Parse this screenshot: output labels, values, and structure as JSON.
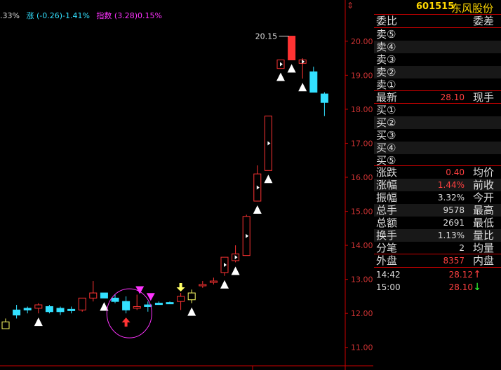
{
  "top_info": {
    "pct_partial": ".33%",
    "rise_label": "涨",
    "rise_value": "(-0.26)-1.41%",
    "index_label": "指数",
    "index_value": "(3.28)0.15%"
  },
  "chart_data": {
    "type": "candlestick",
    "y_ticks": [
      "20.00",
      "19.00",
      "18.00",
      "17.00",
      "16.00",
      "15.00",
      "14.00",
      "13.00",
      "12.00",
      "11.00"
    ],
    "y_tick_values": [
      20,
      19,
      18,
      17,
      16,
      15,
      14,
      13,
      12,
      11
    ],
    "ylim": [
      10.5,
      20.8
    ],
    "peak_label": "20.15",
    "peak_value": 20.15,
    "candles": [
      {
        "o": 11.75,
        "h": 11.85,
        "l": 11.55,
        "c": 11.55,
        "color": "yellow"
      },
      {
        "o": 11.95,
        "h": 12.25,
        "l": 11.85,
        "c": 12.1,
        "color": "cyan"
      },
      {
        "o": 12.1,
        "h": 12.2,
        "l": 12.0,
        "c": 12.15,
        "color": "cyan"
      },
      {
        "o": 12.15,
        "h": 12.3,
        "l": 12.0,
        "c": 12.25,
        "color": "red"
      },
      {
        "o": 12.2,
        "h": 12.25,
        "l": 12.0,
        "c": 12.05,
        "color": "cyan"
      },
      {
        "o": 12.05,
        "h": 12.2,
        "l": 11.95,
        "c": 12.15,
        "color": "cyan"
      },
      {
        "o": 12.1,
        "h": 12.2,
        "l": 12.0,
        "c": 12.12,
        "color": "cyan"
      },
      {
        "o": 12.1,
        "h": 12.25,
        "l": 12.05,
        "c": 12.45,
        "color": "red"
      },
      {
        "o": 12.45,
        "h": 12.95,
        "l": 12.35,
        "c": 12.6,
        "color": "red"
      },
      {
        "o": 12.6,
        "h": 12.6,
        "l": 12.45,
        "c": 12.45,
        "color": "cyan"
      },
      {
        "o": 12.45,
        "h": 12.55,
        "l": 12.3,
        "c": 12.35,
        "color": "cyan"
      },
      {
        "o": 12.35,
        "h": 12.5,
        "l": 12.0,
        "c": 12.1,
        "color": "cyan"
      },
      {
        "o": 12.15,
        "h": 12.55,
        "l": 12.1,
        "c": 12.2,
        "color": "red"
      },
      {
        "o": 12.2,
        "h": 12.35,
        "l": 12.05,
        "c": 12.25,
        "color": "cyan"
      },
      {
        "o": 12.3,
        "h": 12.35,
        "l": 12.25,
        "c": 12.3,
        "color": "cyan"
      },
      {
        "o": 12.3,
        "h": 12.35,
        "l": 12.3,
        "c": 12.32,
        "color": "cyan"
      },
      {
        "o": 12.35,
        "h": 12.6,
        "l": 12.1,
        "c": 12.5,
        "color": "red"
      },
      {
        "o": 12.4,
        "h": 12.7,
        "l": 12.3,
        "c": 12.6,
        "color": "yellow"
      },
      {
        "o": 12.85,
        "h": 12.95,
        "l": 12.75,
        "c": 12.85,
        "color": "red"
      },
      {
        "o": 12.95,
        "h": 13.05,
        "l": 12.85,
        "c": 12.95,
        "color": "red"
      },
      {
        "o": 13.2,
        "h": 13.3,
        "l": 13.1,
        "c": 13.65,
        "color": "red"
      },
      {
        "o": 13.55,
        "h": 14.0,
        "l": 13.5,
        "c": 13.75,
        "color": "red"
      },
      {
        "o": 13.7,
        "h": 14.9,
        "l": 13.7,
        "c": 14.85,
        "color": "red"
      },
      {
        "o": 15.3,
        "h": 16.35,
        "l": 15.3,
        "c": 16.1,
        "color": "red"
      },
      {
        "o": 16.2,
        "h": 17.8,
        "l": 16.2,
        "c": 17.8,
        "color": "red"
      },
      {
        "o": 19.2,
        "h": 19.45,
        "l": 19.2,
        "c": 19.45,
        "color": "red"
      },
      {
        "o": 19.45,
        "h": 20.15,
        "l": 19.45,
        "c": 20.15,
        "color": "redfill"
      },
      {
        "o": 19.45,
        "h": 19.5,
        "l": 18.9,
        "c": 19.35,
        "color": "red"
      },
      {
        "o": 19.1,
        "h": 19.25,
        "l": 18.5,
        "c": 18.5,
        "color": "cyan"
      },
      {
        "o": 18.45,
        "h": 18.5,
        "l": 17.8,
        "c": 18.2,
        "color": "cyan"
      }
    ]
  },
  "panel": {
    "code": "601515",
    "name": "东风股份",
    "weibi": "委比",
    "weicha": "委差",
    "sell": [
      "卖⑤",
      "卖④",
      "卖③",
      "卖②",
      "卖①"
    ],
    "latest_label": "最新",
    "latest_value": "28.10",
    "xianshou": "现手",
    "buy": [
      "买①",
      "买②",
      "买③",
      "买④",
      "买⑤"
    ],
    "stats": [
      {
        "l1": "涨跌",
        "v": "0.40",
        "l2": "均价",
        "red": true
      },
      {
        "l1": "涨幅",
        "v": "1.44%",
        "l2": "前收",
        "red": true
      },
      {
        "l1": "振幅",
        "v": "3.32%",
        "l2": "今开",
        "red": false
      },
      {
        "l1": "总手",
        "v": "9578",
        "l2": "最高",
        "red": false
      },
      {
        "l1": "总额",
        "v": "2691",
        "l2": "最低",
        "red": false
      },
      {
        "l1": "换手",
        "v": "1.13%",
        "l2": "量比",
        "red": false
      },
      {
        "l1": "分笔",
        "v": "2",
        "l2": "均量",
        "red": false
      }
    ],
    "waipan": "外盘",
    "waipan_value": "8357",
    "neipan": "内盘",
    "ticks": [
      {
        "time": "14:42",
        "price": "28.12",
        "dir": "up"
      },
      {
        "time": "15:00",
        "price": "28.10",
        "dir": "down"
      }
    ]
  },
  "colors": {
    "red": "#ff3333",
    "cyan": "#33e0ff",
    "yellow": "#ffff66",
    "magenta": "#ff33ff",
    "white": "#ffffff",
    "green": "#33ff33"
  }
}
